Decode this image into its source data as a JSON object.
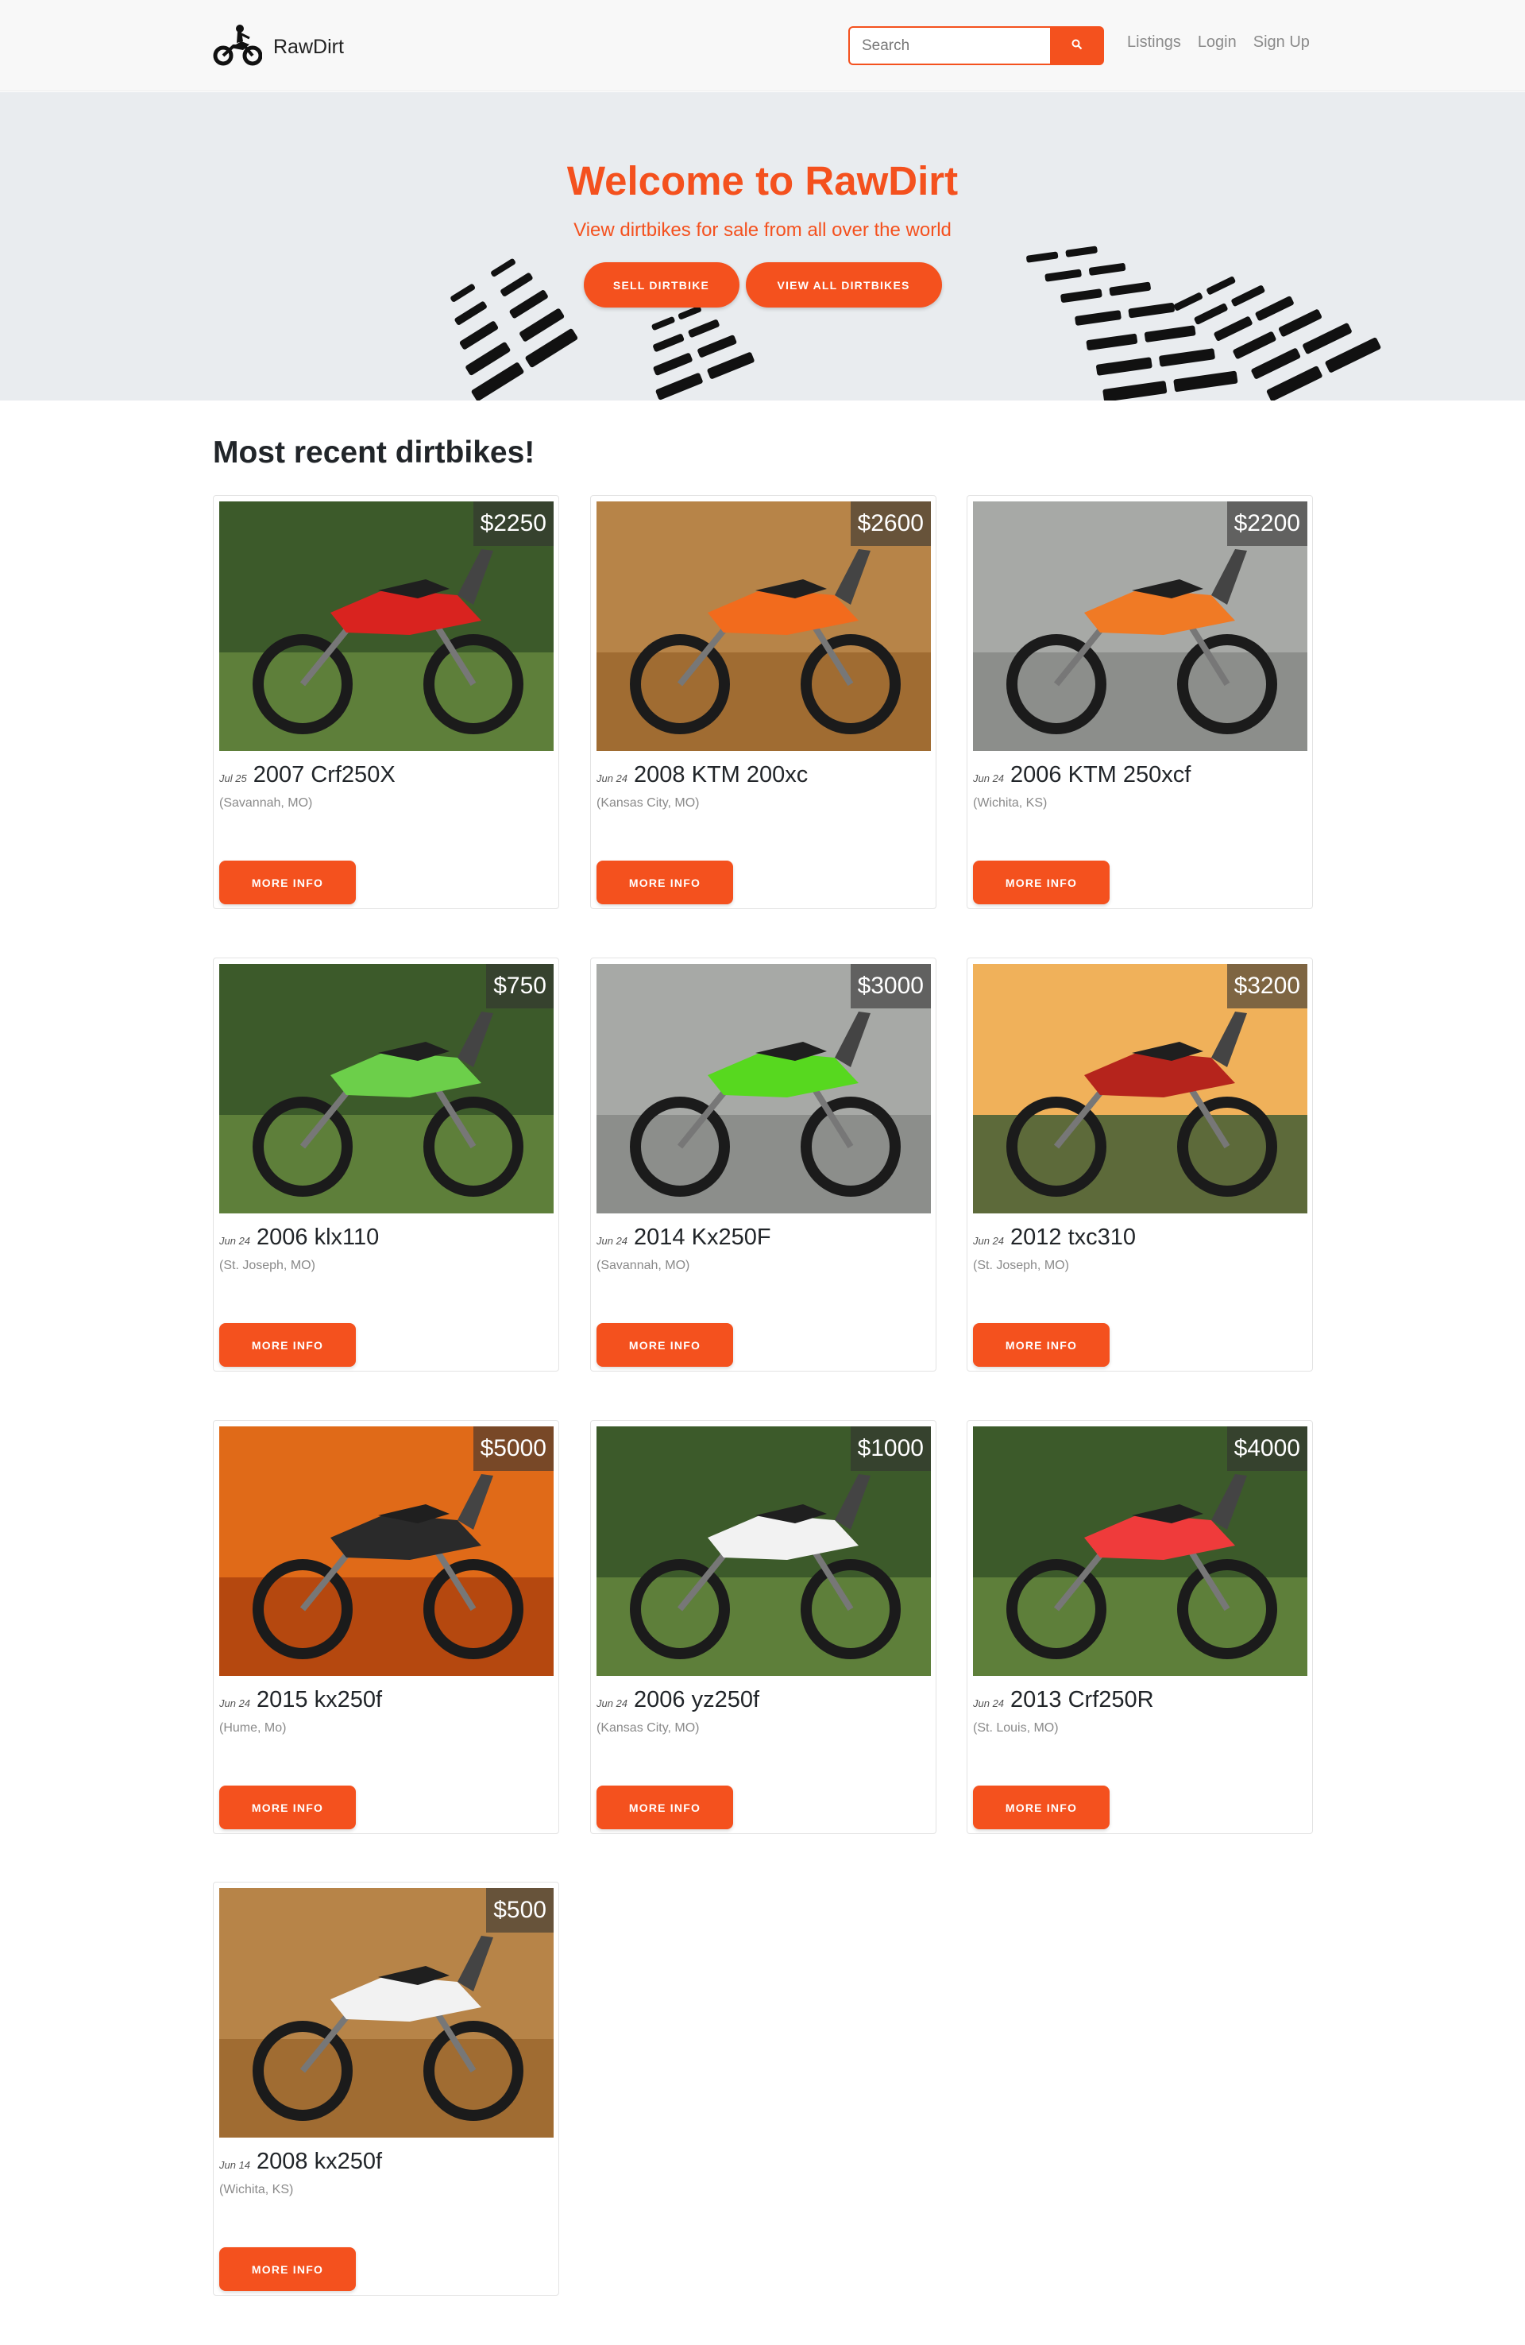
{
  "brand": {
    "name": "RawDirt",
    "logo_icon": "dirtbike-rider-icon"
  },
  "search": {
    "placeholder": "Search",
    "icon": "search-icon"
  },
  "nav": {
    "links": [
      "Listings",
      "Login",
      "Sign Up"
    ]
  },
  "hero": {
    "title": "Welcome to RawDirt",
    "subtitle": "View dirtbikes for sale from all over the world",
    "sell_label": "SELL DIRTBIKE",
    "view_all_label": "VIEW ALL DIRTBIKES"
  },
  "section_title": "Most recent dirtbikes!",
  "more_info_label": "MORE INFO",
  "colors": {
    "accent": "#f4511e",
    "hero_bg": "#e9ecef",
    "navbar_bg": "#f8f8f8"
  },
  "listings": [
    {
      "price": "$2250",
      "date": "Jul 25",
      "title": "2007 Crf250X",
      "location": "(Savannah, MO)",
      "bike_color": "#d9231f",
      "scene": "grass"
    },
    {
      "price": "$2600",
      "date": "Jun 24",
      "title": "2008 KTM 200xc",
      "location": "(Kansas City, MO)",
      "bike_color": "#f26b1d",
      "scene": "wood"
    },
    {
      "price": "$2200",
      "date": "Jun 24",
      "title": "2006 KTM 250xcf",
      "location": "(Wichita, KS)",
      "bike_color": "#f07a25",
      "scene": "wall"
    },
    {
      "price": "$750",
      "date": "Jun 24",
      "title": "2006 klx110",
      "location": "(St. Joseph, MO)",
      "bike_color": "#6ccf4a",
      "scene": "grass"
    },
    {
      "price": "$3000",
      "date": "Jun 24",
      "title": "2014 Kx250F",
      "location": "(Savannah, MO)",
      "bike_color": "#57d81f",
      "scene": "wall"
    },
    {
      "price": "$3200",
      "date": "Jun 24",
      "title": "2012 txc310",
      "location": "(St. Joseph, MO)",
      "bike_color": "#b5241c",
      "scene": "sunset"
    },
    {
      "price": "$5000",
      "date": "Jun 24",
      "title": "2015 kx250f",
      "location": "(Hume, Mo)",
      "bike_color": "#2a2a2a",
      "scene": "autumn"
    },
    {
      "price": "$1000",
      "date": "Jun 24",
      "title": "2006 yz250f",
      "location": "(Kansas City, MO)",
      "bike_color": "#f2f2f2",
      "scene": "grass"
    },
    {
      "price": "$4000",
      "date": "Jun 24",
      "title": "2013 Crf250R",
      "location": "(St. Louis, MO)",
      "bike_color": "#ef3b3b",
      "scene": "grass"
    },
    {
      "price": "$500",
      "date": "Jun 14",
      "title": "2008 kx250f",
      "location": "(Wichita, KS)",
      "bike_color": "#f2f2f2",
      "scene": "wood"
    }
  ]
}
